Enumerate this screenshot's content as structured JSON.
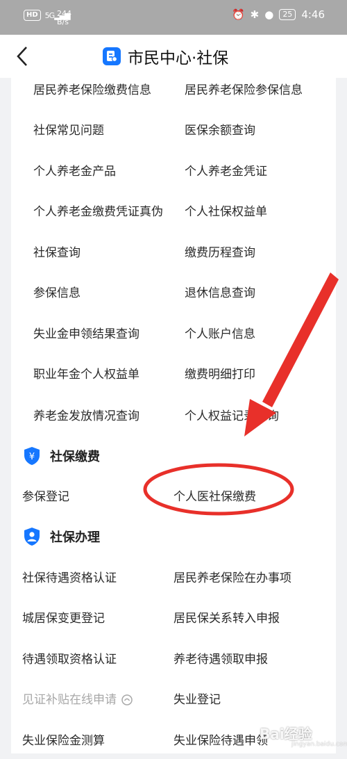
{
  "status_bar": {
    "hd": "HD",
    "signal": "5G",
    "speed_value": "244",
    "speed_unit": "B/s",
    "battery": "25",
    "time": "4:46"
  },
  "header": {
    "title": "市民中心·社保"
  },
  "query_rows": [
    [
      "居民养老保险缴费信息",
      "居民养老保险参保信息"
    ],
    [
      "社保常见问题",
      "医保余额查询"
    ],
    [
      "个人养老金产品",
      "个人养老金凭证"
    ],
    [
      "个人养老金缴费凭证真伪",
      "个人社保权益单"
    ],
    [
      "社保查询",
      "缴费历程查询"
    ],
    [
      "参保信息",
      "退休信息查询"
    ],
    [
      "失业金申领结果查询",
      "个人账户信息"
    ],
    [
      "职业年金个人权益单",
      "缴费明细打印"
    ],
    [
      "养老金发放情况查询",
      "个人权益记录查询"
    ]
  ],
  "payment_section": {
    "title": "社保缴费",
    "items": [
      "参保登记",
      "个人医社保缴费"
    ]
  },
  "handling_section": {
    "title": "社保办理",
    "rows": [
      [
        "社保待遇资格认证",
        "居民养老保险在办事项"
      ],
      [
        "城居保变更登记",
        "居民保关系转入申报"
      ],
      [
        "待遇领取资格认证",
        "养老待遇领取申报"
      ],
      [
        "见证补贴在线申请",
        "失业登记"
      ],
      [
        "失业保险金测算",
        "失业保险待遇申领"
      ]
    ]
  },
  "watermark": {
    "text": "Bai经验",
    "sub": "jingyan.baidu.com"
  },
  "colors": {
    "accent": "#1677ff",
    "annotation": "#e8302a",
    "status_bar": "#a9a9a9"
  }
}
